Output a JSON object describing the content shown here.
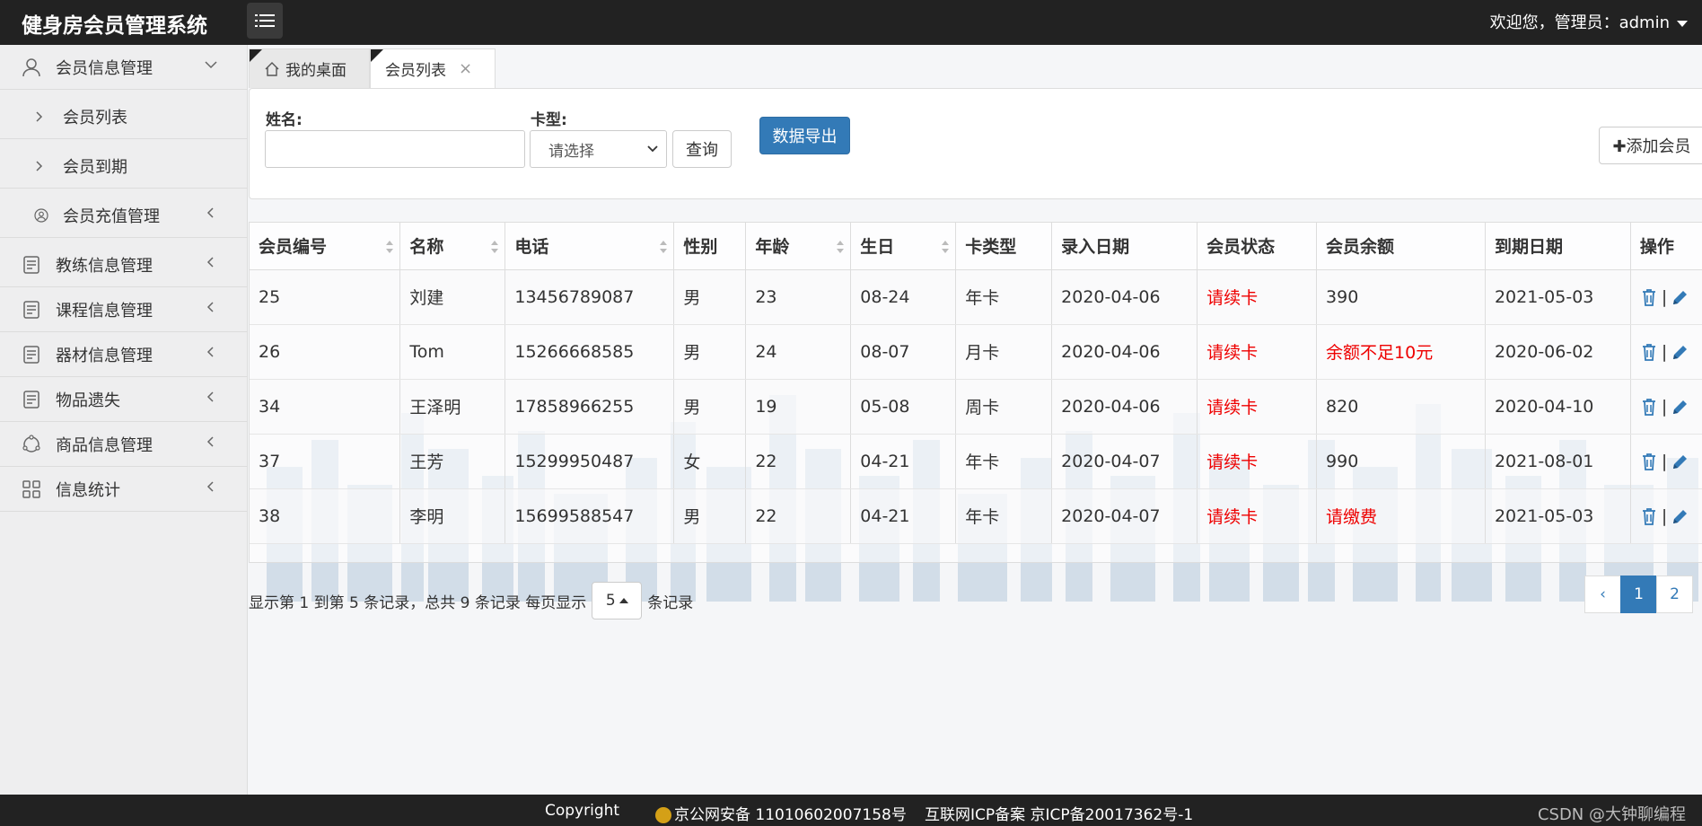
{
  "app": {
    "title": "健身房会员管理系统",
    "welcome": "欢迎您，管理员：admin"
  },
  "sidebar": {
    "items": [
      {
        "label": "会员信息管理",
        "icon": "user-icon"
      },
      {
        "label": "会员列表",
        "icon": "chevron-right-icon"
      },
      {
        "label": "会员到期",
        "icon": "chevron-right-icon"
      },
      {
        "label": "会员充值管理",
        "icon": "user-circle-icon"
      },
      {
        "label": "教练信息管理",
        "icon": "document-icon"
      },
      {
        "label": "课程信息管理",
        "icon": "document-icon"
      },
      {
        "label": "器材信息管理",
        "icon": "document-icon"
      },
      {
        "label": "物品遗失",
        "icon": "document-icon"
      },
      {
        "label": "商品信息管理",
        "icon": "cycle-icon"
      },
      {
        "label": "信息统计",
        "icon": "grid-icon"
      }
    ]
  },
  "tabs": [
    {
      "label": "我的桌面"
    },
    {
      "label": "会员列表"
    }
  ],
  "search": {
    "name_label": "姓名:",
    "name_value": "",
    "card_label": "卡型:",
    "card_value": "请选择",
    "query_label": "查询",
    "export_label": "数据导出",
    "add_label": "✚添加会员"
  },
  "table": {
    "headers": [
      "会员编号",
      "名称",
      "电话",
      "性别",
      "年龄",
      "生日",
      "卡类型",
      "录入日期",
      "会员状态",
      "会员余额",
      "到期日期",
      "操作"
    ],
    "rows": [
      [
        "25",
        "刘建",
        "13456789087",
        "男",
        "23",
        "08-24",
        "年卡",
        "2020-04-06",
        "请续卡",
        "390",
        "2021-05-03"
      ],
      [
        "26",
        "Tom",
        "15266668585",
        "男",
        "24",
        "08-07",
        "月卡",
        "2020-04-06",
        "请续卡",
        "余额不足10元",
        "2020-06-02"
      ],
      [
        "34",
        "王泽明",
        "17858966255",
        "男",
        "19",
        "05-08",
        "周卡",
        "2020-04-06",
        "请续卡",
        "820",
        "2020-04-10"
      ],
      [
        "37",
        "王芳",
        "15299950487",
        "女",
        "22",
        "04-21",
        "年卡",
        "2020-04-07",
        "请续卡",
        "990",
        "2021-08-01"
      ],
      [
        "38",
        "李明",
        "15699588547",
        "男",
        "22",
        "04-21",
        "年卡",
        "2020-04-07",
        "请续卡",
        "请缴费",
        "2021-05-03"
      ]
    ],
    "sep": "|"
  },
  "pager": {
    "info_prefix": "显示第 1 到第 5 条记录，总共 9 条记录 每页显示",
    "page_size": "5",
    "info_suffix": "条记录",
    "prev": "‹",
    "pages": [
      "1",
      "2"
    ]
  },
  "footer": {
    "copyright": "Copyright",
    "police": "京公网安备 11010602007158号",
    "icp": "互联网ICP备案 京ICP备20017362号-1",
    "csdn": "CSDN @大钟聊编程"
  },
  "colors": {
    "primary": "#337ab7",
    "alert": "#ee0000",
    "topbar": "#222222"
  }
}
